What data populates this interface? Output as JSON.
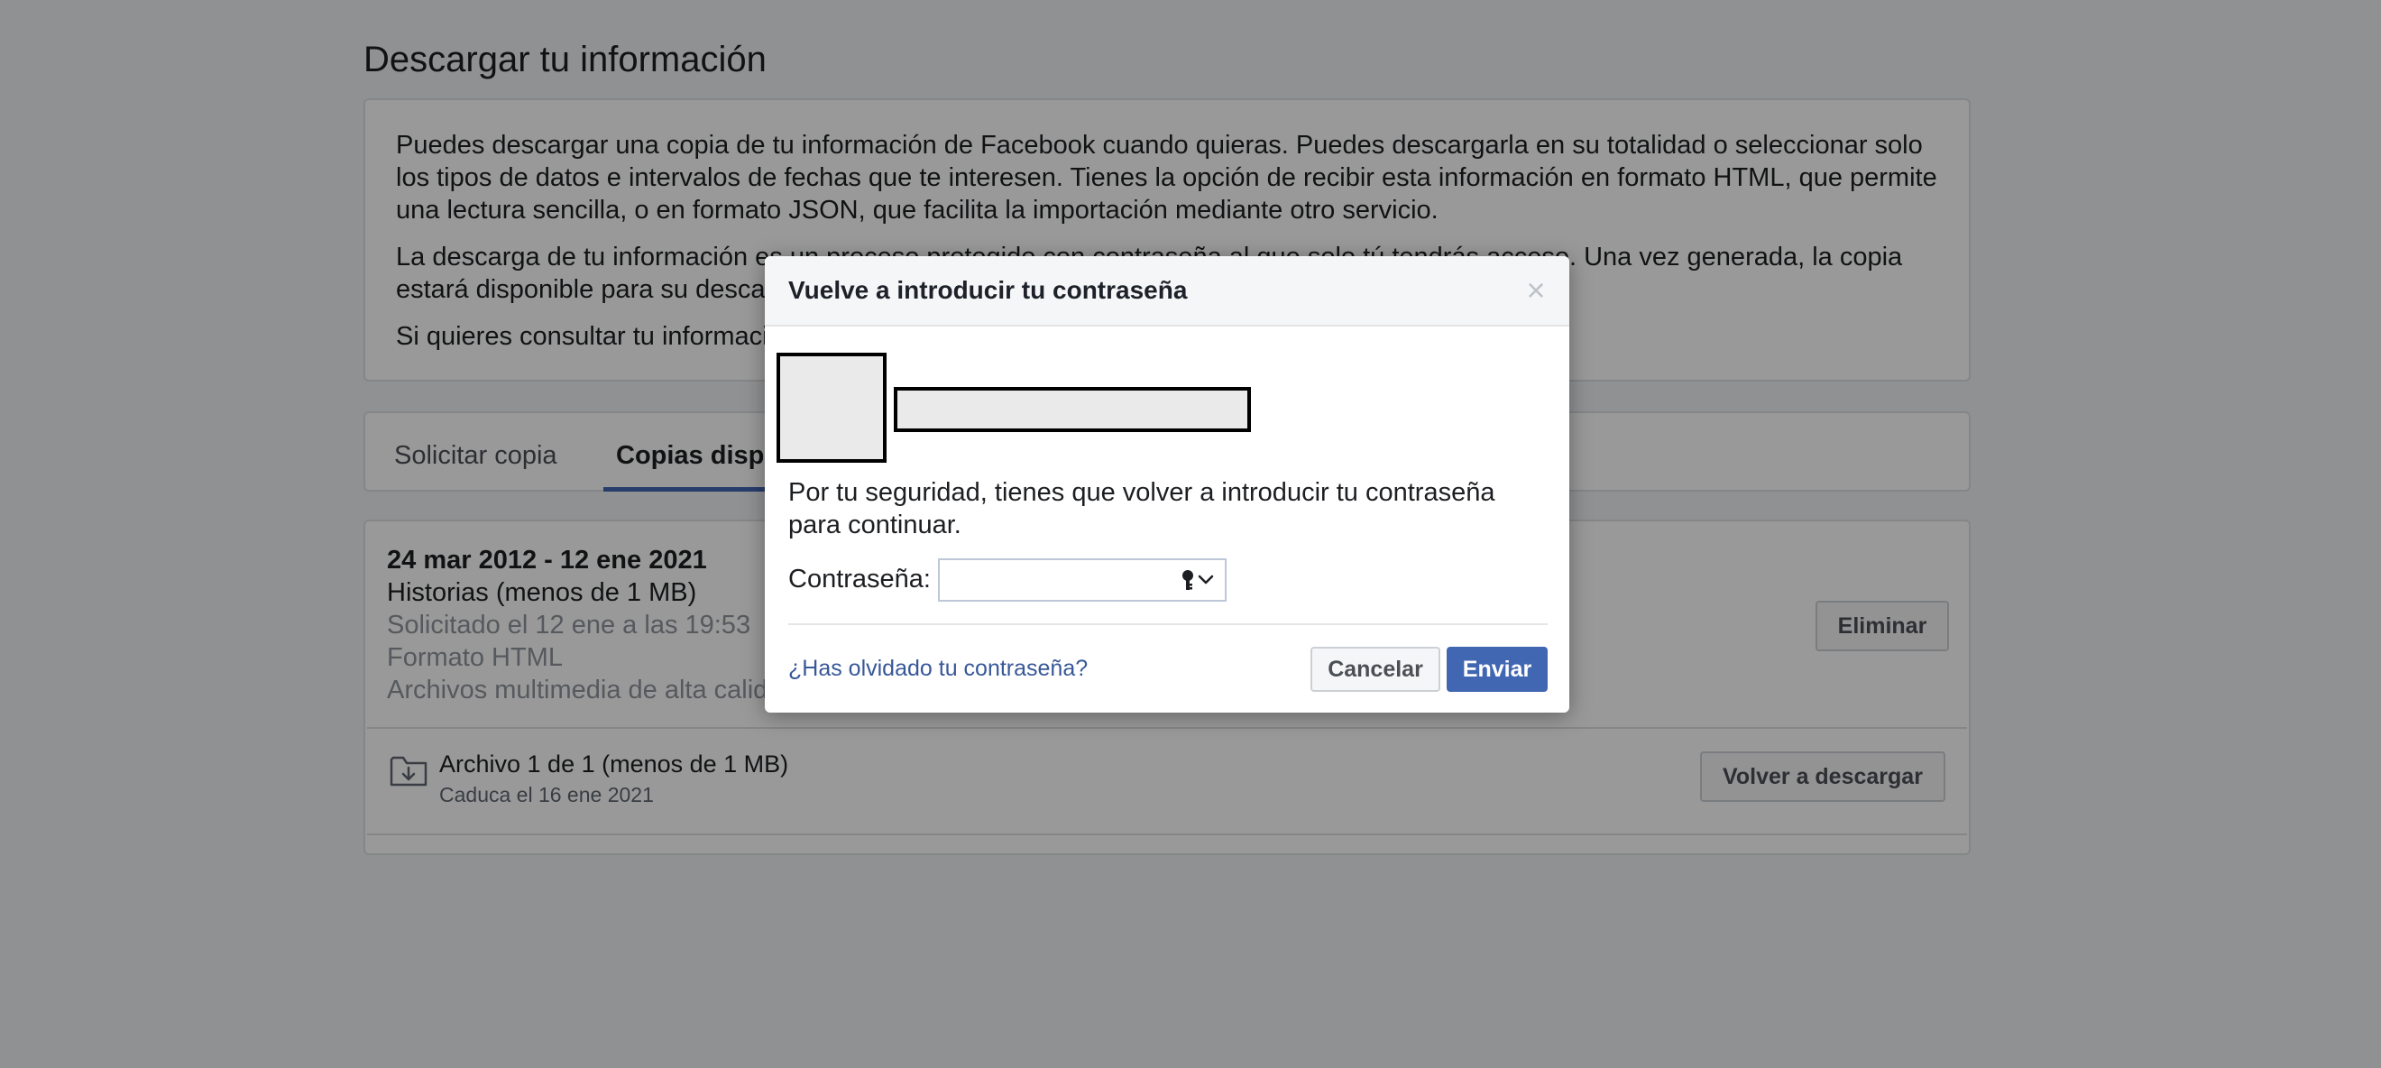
{
  "page": {
    "title": "Descargar tu información"
  },
  "info": {
    "paragraphs": [
      "Puedes descargar una copia de tu información de Facebook cuando quieras. Puedes descargarla en su totalidad o seleccionar solo los tipos de datos e intervalos de fechas que te interesen. Tienes la opción de recibir esta información en formato HTML, que permite una lectura sencilla, o en formato JSON, que facilita la importación mediante otro servicio.",
      "La descarga de tu información es un proceso protegido con contraseña al que solo tú tendrás acceso. Una vez generada, la copia estará disponible para su descarga",
      "Si quieres consultar tu informació"
    ]
  },
  "tabs": {
    "request": "Solicitar copia",
    "available": "Copias dispo"
  },
  "copy": {
    "range": "24 mar 2012 - 12 ene 2021",
    "type": "Historias (menos de 1 MB)",
    "requested": "Solicitado el 12 ene a las 19:53",
    "format": "Formato HTML",
    "media": "Archivos multimedia de alta calid",
    "delete_label": "Eliminar",
    "file": {
      "name": "Archivo 1 de 1 (menos de 1 MB)",
      "expiry": "Caduca el 16 ene 2021",
      "redownload_label": "Volver a descargar",
      "icon": "download-folder-icon"
    }
  },
  "modal": {
    "title": "Vuelve a introducir tu contraseña",
    "close_symbol": "×",
    "message": "Por tu seguridad, tienes que volver a introducir tu contraseña para continuar.",
    "password_label": "Contraseña:",
    "password_value": "",
    "password_icon": "key-dropdown-icon",
    "forgot_link": "¿Has olvidado tu contraseña?",
    "cancel_label": "Cancelar",
    "submit_label": "Enviar"
  },
  "colors": {
    "accent": "#4267b2",
    "link": "#385898",
    "muted_text": "#90949c",
    "overlay": "rgba(0,0,0,0.4)"
  }
}
